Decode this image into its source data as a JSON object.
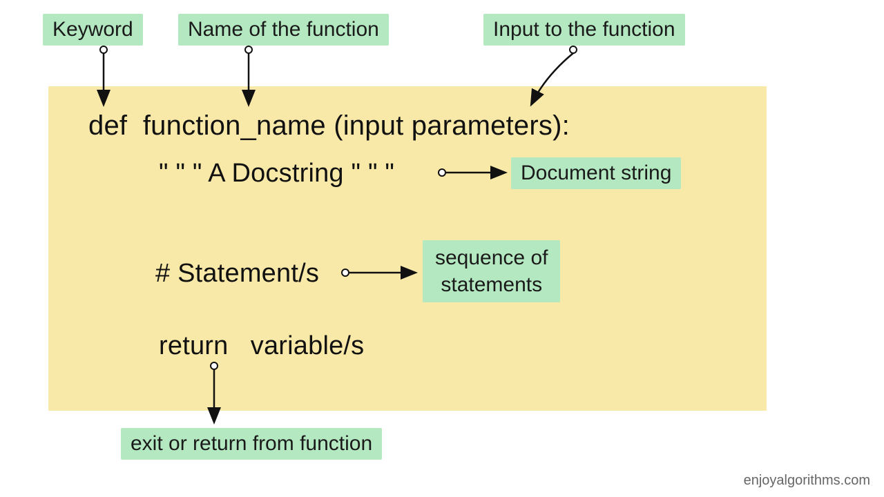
{
  "labels": {
    "keyword": "Keyword",
    "name_of_function": "Name of the function",
    "input_to_function": "Input to the function",
    "document_string": "Document string",
    "sequence_of_statements_l1": "sequence of",
    "sequence_of_statements_l2": "statements",
    "exit_or_return": "exit or return from function"
  },
  "code": {
    "signature_def": "def",
    "signature_name": "function_name",
    "signature_params": "(input parameters):",
    "docstring": "\" \" \" A Docstring \" \" \"",
    "statements": "# Statement/s",
    "return_kw": "return",
    "return_var": "variable/s"
  },
  "watermark": "enjoyalgorithms.com"
}
